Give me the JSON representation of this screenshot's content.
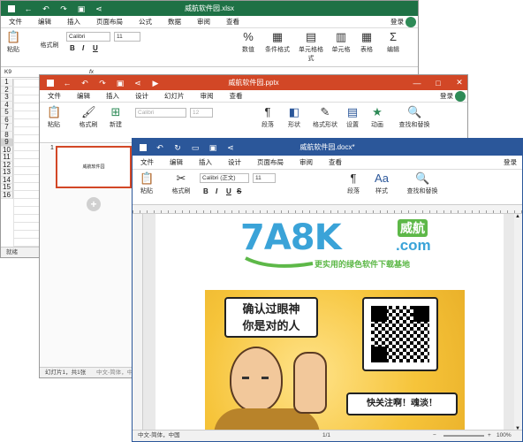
{
  "excel": {
    "title": "威航软件园.xlsx",
    "menu": [
      "文件",
      "编辑",
      "插入",
      "页面布局",
      "公式",
      "数据",
      "审阅",
      "查看"
    ],
    "login": "登录",
    "font": "Calibri",
    "size": "11",
    "buttons": {
      "paste": "粘贴",
      "format_painter": "格式刷",
      "number": "数值",
      "cond_format": "条件格式",
      "cell_format": "单元格格式",
      "cell": "单元格",
      "sheet": "表格",
      "edit": "编辑"
    },
    "cell_ref": "K9",
    "fx": "fx",
    "rows": [
      "1",
      "2",
      "3",
      "4",
      "5",
      "6",
      "7",
      "8",
      "9",
      "10",
      "11",
      "12",
      "13",
      "14",
      "15",
      "16"
    ],
    "active_row": "9",
    "status": "就绪",
    "accent": "#1e7145"
  },
  "ppt": {
    "title": "威航软件园.pptx",
    "menu": [
      "文件",
      "编辑",
      "插入",
      "设计",
      "幻灯片",
      "审阅",
      "查看"
    ],
    "login": "登录",
    "font": "Calibri",
    "size": "12",
    "buttons": {
      "paste": "粘贴",
      "format_painter": "格式刷",
      "new": "新建",
      "paragraph": "段落",
      "shape": "形状",
      "shape_format": "格式形状",
      "arrange": "设置",
      "animation": "动画",
      "find_replace": "查找和替换"
    },
    "slide_number": "1",
    "slide_text": "威航软件园",
    "status": "幻灯片1，共1张",
    "status2": "中文-简体，中国",
    "accent": "#d24726"
  },
  "word": {
    "title": "威航软件园.docx*",
    "menu": [
      "文件",
      "编辑",
      "插入",
      "设计",
      "页面布局",
      "审阅",
      "查看"
    ],
    "login": "登录",
    "font": "Calibri (正文)",
    "size": "11",
    "buttons": {
      "paste": "粘贴",
      "format_painter": "格式刷",
      "paragraph": "段落",
      "style": "样式",
      "find_replace": "查找和替换"
    },
    "logo_text": "7A8K",
    "logo_cn": "威航",
    "logo_dotcom": ".com",
    "slogan": "更实用的绿色软件下载基地",
    "bubble1_line1": "确认过眼神",
    "bubble1_line2": "你是对的人",
    "bubble2": "快关注啊！魂淡！",
    "status_lang": "中文-简体，中国",
    "status_page": "1/1",
    "zoom": "100%",
    "accent": "#2b579a"
  }
}
